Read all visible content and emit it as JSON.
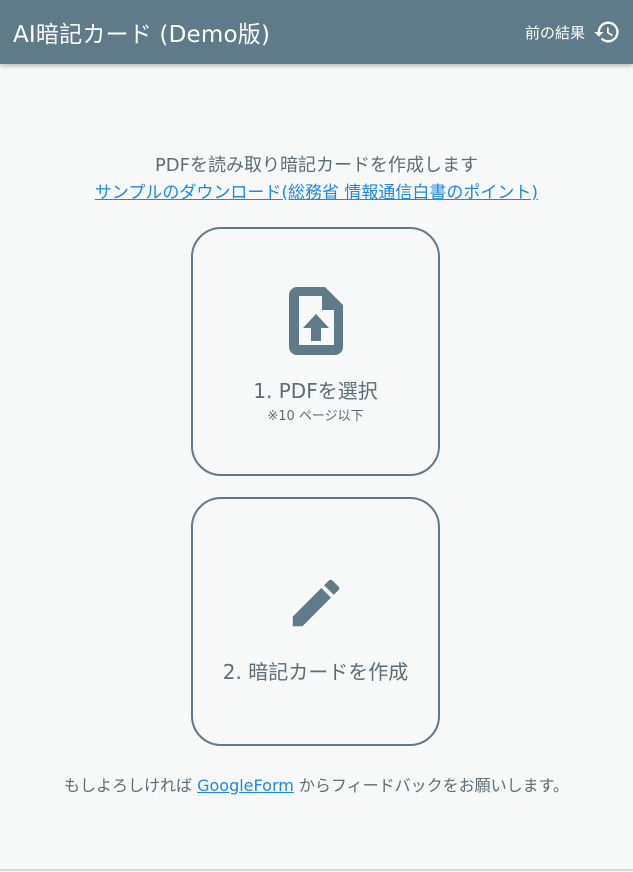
{
  "header": {
    "title": "AI暗記カード (Demo版)",
    "history_label": "前の結果",
    "history_icon": "history-icon"
  },
  "intro": {
    "text": "PDFを読み取り暗記カードを作成します",
    "sample_link": "サンプルのダウンロード(総務省 情報通信白書のポイント)"
  },
  "cards": {
    "select": {
      "label": "1. PDFを選択",
      "note": "※10 ページ以下",
      "icon": "file-upload-icon"
    },
    "create": {
      "label": "2. 暗記カードを作成",
      "icon": "pencil-icon"
    }
  },
  "footer": {
    "prefix": "もしよろしければ",
    "link": "GoogleForm",
    "suffix": "からフィードバックをお願いします。"
  },
  "colors": {
    "app_bar": "#5f7b89",
    "link": "#1e88e5",
    "text": "#5b6e78",
    "background": "#f7f8f8"
  }
}
